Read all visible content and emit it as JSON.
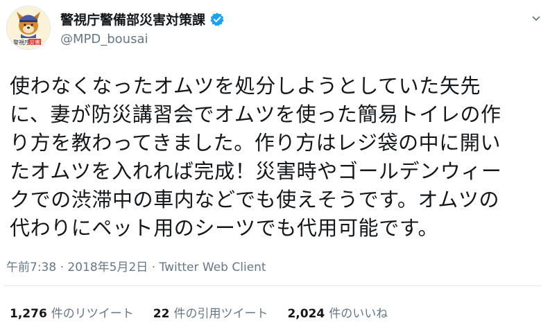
{
  "author": {
    "display_name": "警視庁警備部災害対策課",
    "handle": "@MPD_bousai",
    "avatar_icon": "dog-mascot-avatar-icon",
    "avatar_caption_left": "警視庁",
    "avatar_caption_right": "災害",
    "verified_icon": "verified-badge-icon",
    "verified_color": "#1da1f2"
  },
  "tweet": {
    "text": "使わなくなったオムツを処分しようとしていた矢先\nに、妻が防災講習会でオムツを使った簡易トイレの作\nり方を教わってきました。作り方はレジ袋の中に開い\nたオムツを入れれば完成！災害時やゴールデンウィー\nクでの渋滞中の車内などでも使えそうです。オムツの\n代わりにペット用のシーツでも代用可能です。"
  },
  "meta": {
    "time": "午前7:38",
    "separator": "·",
    "date": "2018年5月2日",
    "client": "Twitter Web Client"
  },
  "stats": {
    "retweets_count": "1,276",
    "retweets_label": "件のリツイート",
    "quotes_count": "22",
    "quotes_label": "件の引用ツイート",
    "likes_count": "2,024",
    "likes_label": "件のいいね"
  },
  "colors": {
    "text_primary": "#14171a",
    "text_secondary": "#657786",
    "divider": "#e1e8ed",
    "accent": "#1da1f2"
  }
}
